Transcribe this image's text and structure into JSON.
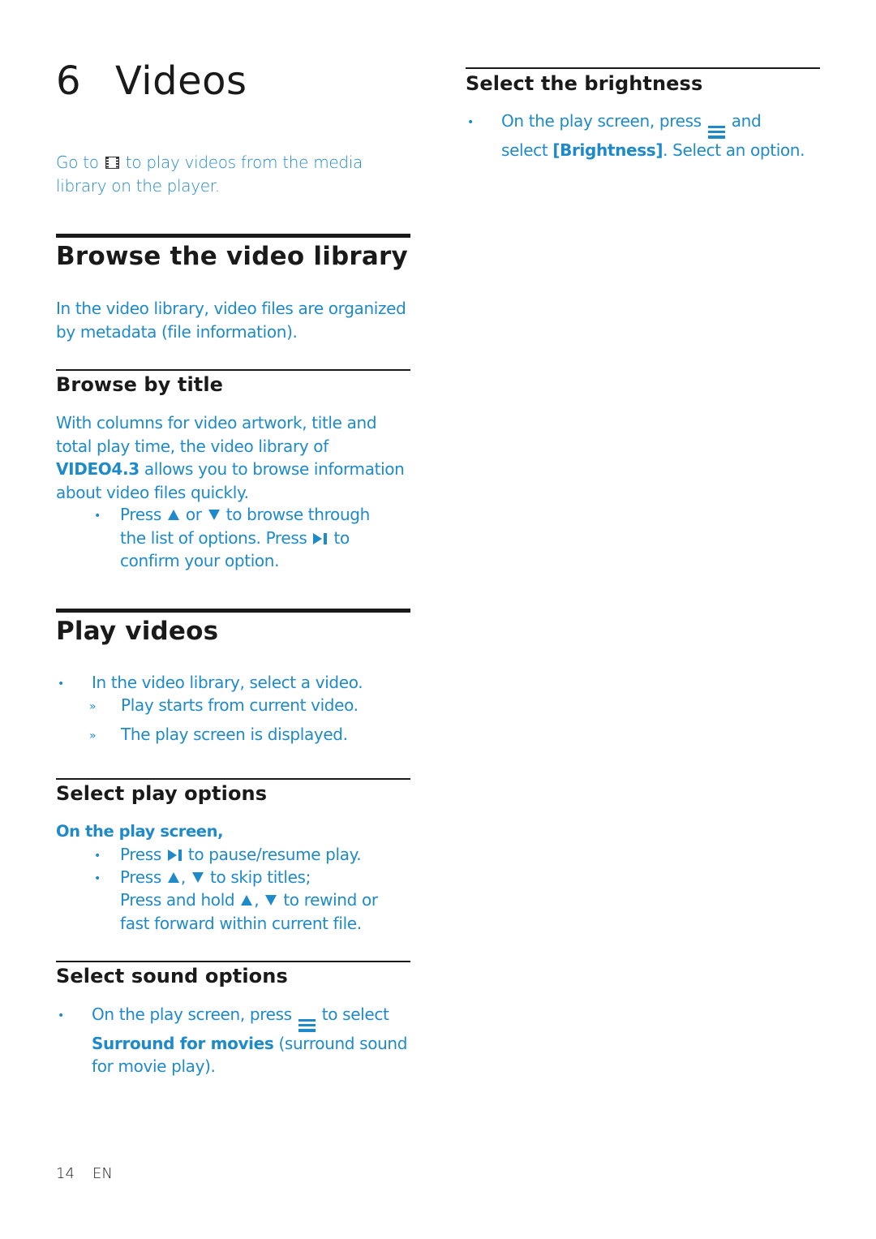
{
  "chapter": {
    "number": "6",
    "title": "Videos"
  },
  "intro": {
    "before": "Go to",
    "icon": "film-icon",
    "after": "to play videos from the media library on the player."
  },
  "browse_library": {
    "heading": "Browse the video library",
    "text": "In the video library, video files are organized by metadata (file information)."
  },
  "browse_by_title": {
    "heading": "Browse by title",
    "text_before": "With columns for video artwork, title and total play time, the video library of",
    "product": "VIDEO4.3",
    "text_after": "allows you to browse information about video files quickly.",
    "bullet": {
      "press": "Press",
      "or": "or",
      "browse": "to browse through the list of options. Press",
      "confirm": "to confirm your option."
    }
  },
  "play_videos": {
    "heading": "Play videos",
    "step": "In the video library, select a video.",
    "results": [
      "Play starts from current video.",
      "The play screen is displayed."
    ],
    "result_marker": "»"
  },
  "play_options": {
    "heading": "Select play options",
    "lead": "On the play screen,",
    "bullet1": {
      "press": "Press",
      "rest": "to pause/resume play."
    },
    "bullet2": {
      "press": "Press",
      "comma": ",",
      "rest": "to skip titles;"
    },
    "bullet2b": {
      "press": "Press and hold",
      "comma": ",",
      "rest": "to rewind or fast forward within current file."
    }
  },
  "sound_options": {
    "heading": "Select sound options",
    "text_before": "On the play screen, press",
    "text_mid": "to select",
    "option": "Surround for movies",
    "text_after": "(surround sound for movie play)."
  },
  "brightness": {
    "heading": "Select the brightness",
    "text_before": "On the play screen, press",
    "text_mid": "and select",
    "option": "[Brightness]",
    "text_after": ". Select an option."
  },
  "bullet_marker": "•",
  "footer": {
    "page": "14",
    "lang": "EN"
  },
  "colors": {
    "accent": "#1f8ac9",
    "text": "#1a1a1a"
  }
}
